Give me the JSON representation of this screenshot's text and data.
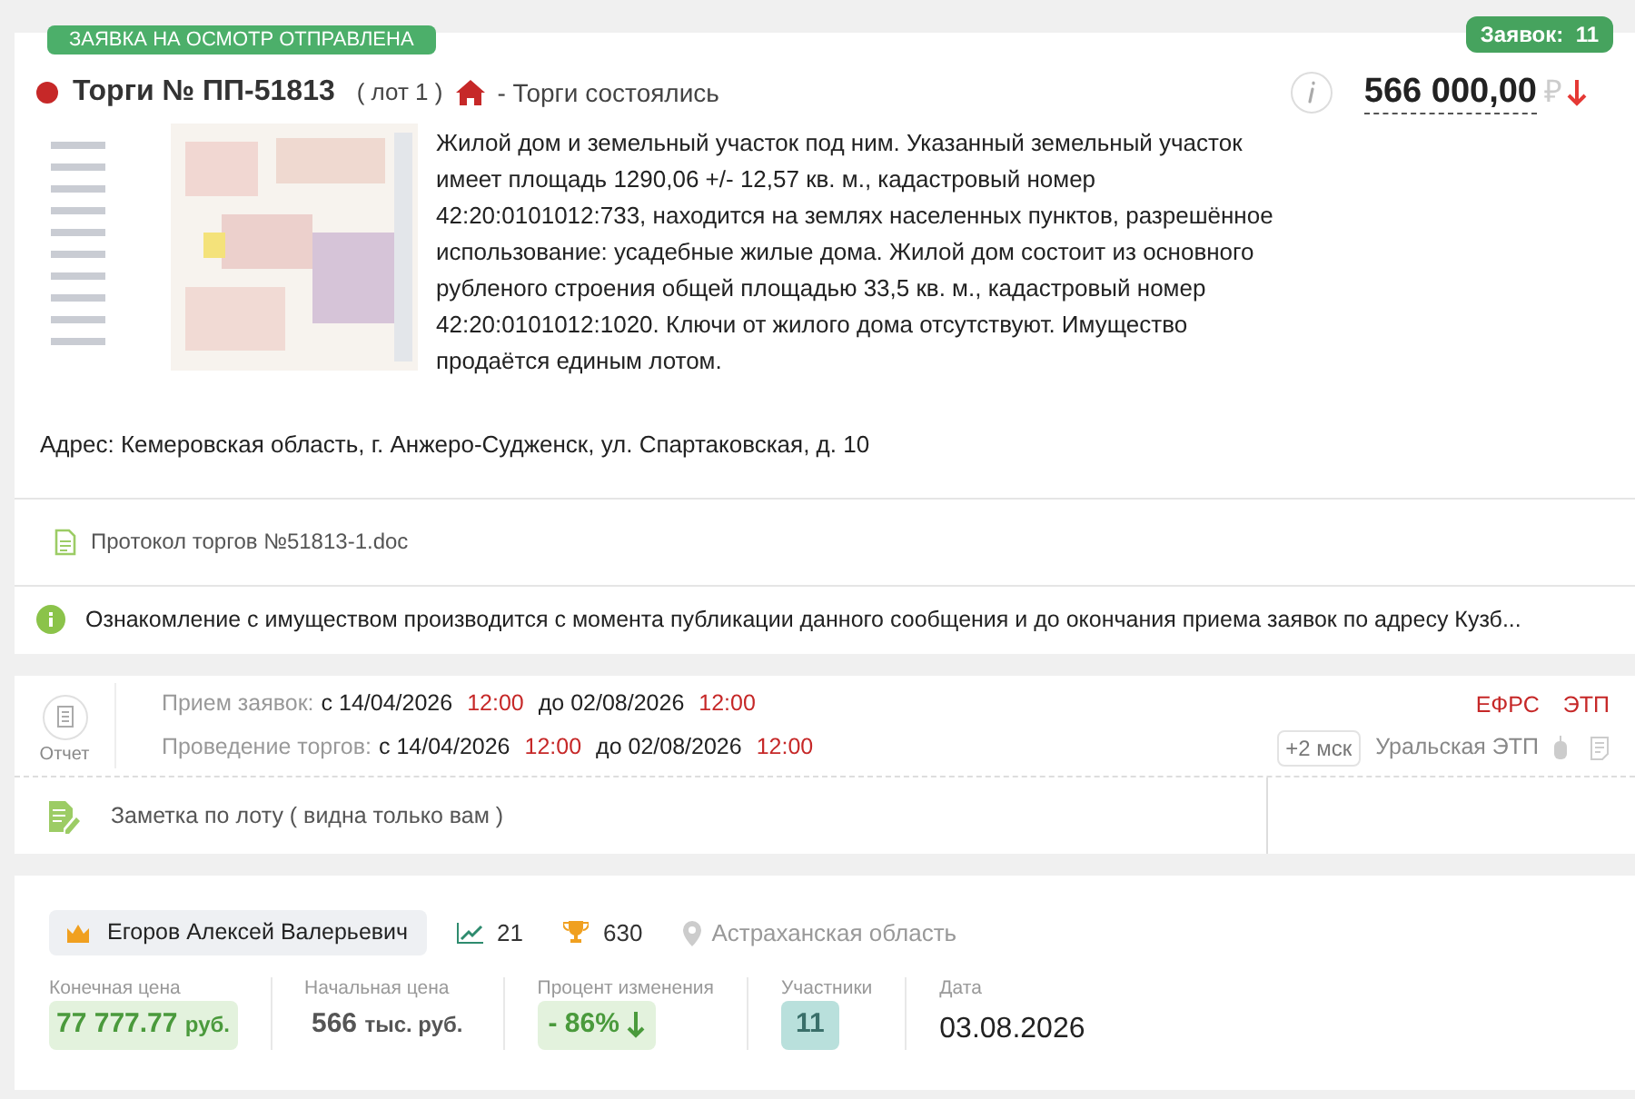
{
  "top_badge": "ЗАЯВКА НА ОСМОТР ОТПРАВЛЕНА",
  "applications": {
    "label": "Заявок:",
    "count": "11"
  },
  "lot": {
    "title": "Торги № ПП-51813",
    "lot_number": "( лот 1 )",
    "status": "- Торги состоялись",
    "price": "566 000,00",
    "currency": "₽",
    "price_down": true,
    "description": "Жилой дом и земельный участок под ним. Указанный земельный участок имеет площадь 1290,06 +/- 12,57 кв. м., кадастровый номер 42:20:0101012:733, находится на землях населенных пунктов, разрешённое использование: усадебные жилые дома. Жилой дом состоит из основного рубленого строения общей площадью 33,5 кв. м., кадастровый номер 42:20:0101012:1020. Ключи от жилого дома отсутствуют. Имущество продаётся единым лотом.",
    "address": "Адрес: Кемеровская область, г. Анжеро-Судженск, ул. Спартаковская, д. 10",
    "document": "Протокол торгов №51813-1.doc",
    "notice": "Ознакомление с имуществом производится с момента публикации данного сообщения и до окончания приема заявок по адресу Кузб..."
  },
  "schedule": {
    "report_label": "Отчет",
    "rows": [
      {
        "label": "Прием заявок:",
        "from": "с 14/04/2026",
        "from_time": "12:00",
        "to": "до 02/08/2026",
        "to_time": "12:00"
      },
      {
        "label": "Проведение торгов:",
        "from": "с 14/04/2026",
        "from_time": "12:00",
        "to": "до 02/08/2026",
        "to_time": "12:00"
      }
    ],
    "links": [
      "ЕФРС",
      "ЭТП"
    ],
    "timezone": "+2 мск",
    "platform": "Уральская ЭТП",
    "note": "Заметка по лоту ( видна только вам )"
  },
  "winner": {
    "name": "Егоров Алексей Валерьевич",
    "rating": "21",
    "trophies": "630",
    "region": "Астраханская область"
  },
  "stats": [
    {
      "kind": "final",
      "label": "Конечная цена",
      "value": "77 777.77",
      "unit": "руб."
    },
    {
      "kind": "start",
      "label": "Начальная цена",
      "value": "566",
      "unit": "тыс. руб."
    },
    {
      "kind": "change",
      "label": "Процент изменения",
      "value": "- 86%"
    },
    {
      "kind": "count",
      "label": "Участники",
      "value": "11"
    },
    {
      "kind": "date",
      "label": "Дата",
      "value": "03.08.2026"
    }
  ]
}
